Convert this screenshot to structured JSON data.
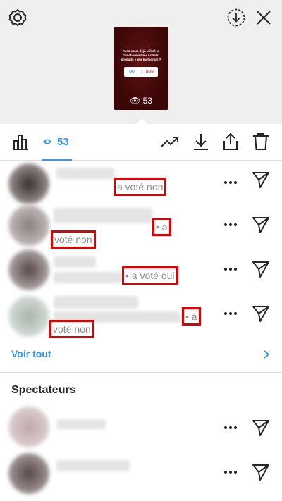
{
  "header": {
    "settings_icon": "gear-icon",
    "download_story_icon": "download-circle-icon",
    "close_icon": "close-icon",
    "story": {
      "question": "Avez-vous déjà utilisé la fonctionnalité « Achats produits » sur Instagram ?",
      "poll_yes": "OUI",
      "poll_no": "NON",
      "views": "53"
    }
  },
  "toolbar": {
    "insights_icon": "bar-chart-icon",
    "viewers_tab_count": "53",
    "viewers_tab_icon": "eye-icon",
    "promote_icon": "trending-up-icon",
    "download_icon": "download-icon",
    "share_icon": "share-icon",
    "delete_icon": "trash-icon"
  },
  "votes": [
    {
      "text": "a voté non"
    },
    {
      "text_line1": "• a",
      "text_line2": "voté non"
    },
    {
      "text": "• a voté oui"
    },
    {
      "text_line1": "• a",
      "text_line2": "voté non"
    }
  ],
  "see_all": "Voir tout",
  "spectators_title": "Spectateurs",
  "colors": {
    "accent": "#3897f0",
    "highlight_box": "#e00000",
    "muted": "#8e8e8e"
  }
}
